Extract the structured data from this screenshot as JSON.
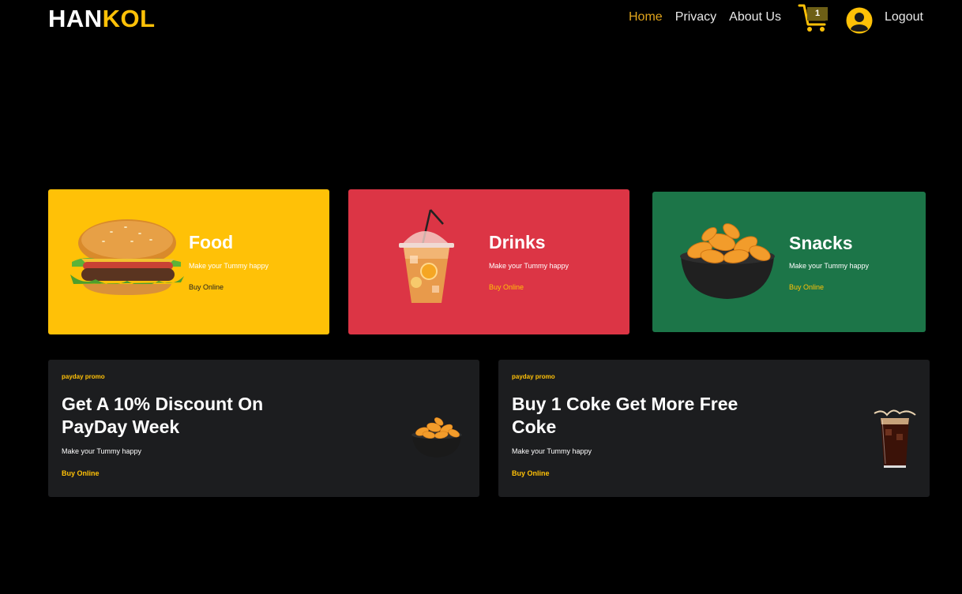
{
  "header": {
    "logo_part1": "HAN",
    "logo_part2": "KOL",
    "nav": [
      "Home",
      "Privacy",
      "About Us"
    ],
    "cart_count": "1",
    "logout_label": "Logout"
  },
  "categories": [
    {
      "title": "Food",
      "subtitle": "Make your Tummy happy",
      "cta": "Buy Online",
      "color": "#FFC107"
    },
    {
      "title": "Drinks",
      "subtitle": "Make your Tummy happy",
      "cta": "Buy Online",
      "color": "#DC3545"
    },
    {
      "title": "Snacks",
      "subtitle": "Make your Tummy happy",
      "cta": "Buy Online",
      "color": "#1C7548"
    }
  ],
  "promos": [
    {
      "tag": "payday promo",
      "title": "Get A 10% Discount On PayDay Week",
      "subtitle": "Make your Tummy happy",
      "cta": "Buy Online"
    },
    {
      "tag": "payday promo",
      "title": "Buy 1 Coke Get More Free Coke",
      "subtitle": "Make your Tummy happy",
      "cta": "Buy Online"
    }
  ],
  "colors": {
    "accent": "#FFC107",
    "background": "#000000",
    "promo_bg": "#1C1D1F"
  },
  "icons": [
    "cart-icon",
    "user-avatar-icon"
  ]
}
